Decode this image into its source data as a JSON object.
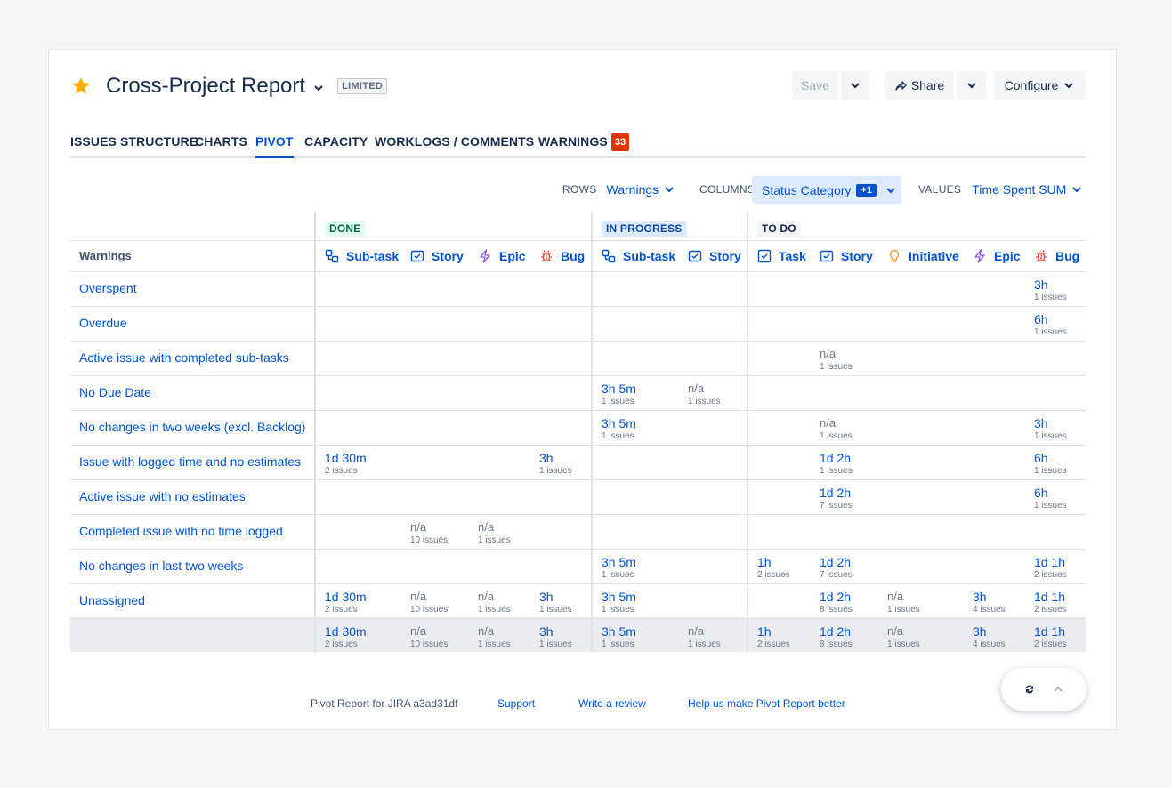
{
  "header": {
    "title": "Cross-Project Report",
    "badge": "LIMITED",
    "save_label": "Save",
    "share_label": "Share",
    "configure_label": "Configure",
    "star_color": "#ffab00"
  },
  "tabs": [
    {
      "label": "ISSUES STRUCTURE"
    },
    {
      "label": "CHARTS"
    },
    {
      "label": "PIVOT",
      "active": true
    },
    {
      "label": "CAPACITY"
    },
    {
      "label": "WORKLOGS / COMMENTS"
    },
    {
      "label": "WARNINGS",
      "count": "33"
    }
  ],
  "controls": {
    "rows_label": "ROWS",
    "rows_value": "Warnings",
    "columns_label": "COLUMNS",
    "columns_value": "Status Category",
    "columns_extra": "+1",
    "values_label": "VALUES",
    "values_value": "Time Spent SUM"
  },
  "pivot": {
    "row_header": "Warnings",
    "groups": [
      {
        "label": "DONE",
        "style": "done"
      },
      {
        "label": "IN PROGRESS",
        "style": "prog"
      },
      {
        "label": "TO DO",
        "style": "todo"
      }
    ],
    "columns": [
      {
        "label": "Sub-task",
        "icon": "subtask-icon"
      },
      {
        "label": "Story",
        "icon": "story-icon"
      },
      {
        "label": "Epic",
        "icon": "epic-icon"
      },
      {
        "label": "Bug",
        "icon": "bug-icon"
      },
      {
        "label": "Sub-task",
        "icon": "subtask-icon"
      },
      {
        "label": "Story",
        "icon": "story-icon"
      },
      {
        "label": "Task",
        "icon": "task-icon"
      },
      {
        "label": "Story",
        "icon": "story-icon"
      },
      {
        "label": "Initiative",
        "icon": "initiative-icon"
      },
      {
        "label": "Epic",
        "icon": "epic-icon"
      },
      {
        "label": "Bug",
        "icon": "bug-icon"
      }
    ],
    "rows": [
      {
        "name": "Overspent",
        "cells": {
          "10": [
            "3h",
            "1 issues"
          ]
        }
      },
      {
        "name": "Overdue",
        "cells": {
          "10": [
            "6h",
            "1 issues"
          ]
        }
      },
      {
        "name": "Active issue with completed sub-tasks",
        "cells": {
          "7": [
            "n/a",
            "1 issues"
          ]
        }
      },
      {
        "name": "No Due Date",
        "cells": {
          "4": [
            "3h 5m",
            "1 issues"
          ],
          "5": [
            "n/a",
            "1 issues"
          ]
        }
      },
      {
        "name": "No changes in two weeks (excl. Backlog)",
        "cells": {
          "4": [
            "3h 5m",
            "1 issues"
          ],
          "7": [
            "n/a",
            "1 issues"
          ],
          "10": [
            "3h",
            "1 issues"
          ]
        }
      },
      {
        "name": "Issue with logged time and no estimates",
        "cells": {
          "0": [
            "1d 30m",
            "2 issues"
          ],
          "3": [
            "3h",
            "1 issues"
          ],
          "7": [
            "1d 2h",
            "1 issues"
          ],
          "10": [
            "6h",
            "1 issues"
          ]
        }
      },
      {
        "name": "Active issue with no estimates",
        "cells": {
          "7": [
            "1d 2h",
            "7 issues"
          ],
          "10": [
            "6h",
            "1 issues"
          ]
        }
      },
      {
        "name": "Completed issue with no time logged",
        "cells": {
          "1": [
            "n/a",
            "10 issues"
          ],
          "2": [
            "n/a",
            "1 issues"
          ]
        }
      },
      {
        "name": "No changes in last two weeks",
        "cells": {
          "4": [
            "3h 5m",
            "1 issues"
          ],
          "6": [
            "1h",
            "2 issues"
          ],
          "7": [
            "1d 2h",
            "7 issues"
          ],
          "10": [
            "1d 1h",
            "2 issues"
          ]
        }
      },
      {
        "name": "Unassigned",
        "cells": {
          "0": [
            "1d 30m",
            "2 issues"
          ],
          "1": [
            "n/a",
            "10 issues"
          ],
          "2": [
            "n/a",
            "1 issues"
          ],
          "3": [
            "3h",
            "1 issues"
          ],
          "4": [
            "3h 5m",
            "1 issues"
          ],
          "7": [
            "1d 2h",
            "8 issues"
          ],
          "8": [
            "n/a",
            "1 issues"
          ],
          "9": [
            "3h",
            "4 issues"
          ],
          "10": [
            "1d 1h",
            "2 issues"
          ]
        }
      },
      {
        "name": "",
        "total": true,
        "cells": {
          "0": [
            "1d 30m",
            "2 issues"
          ],
          "1": [
            "n/a",
            "10 issues"
          ],
          "2": [
            "n/a",
            "1 issues"
          ],
          "3": [
            "3h",
            "1 issues"
          ],
          "4": [
            "3h 5m",
            "1 issues"
          ],
          "5": [
            "n/a",
            "1 issues"
          ],
          "6": [
            "1h",
            "2 issues"
          ],
          "7": [
            "1d 2h",
            "8 issues"
          ],
          "8": [
            "n/a",
            "1 issues"
          ],
          "9": [
            "3h",
            "4 issues"
          ],
          "10": [
            "1d 1h",
            "2 issues"
          ]
        }
      }
    ]
  },
  "footer": {
    "version": "Pivot Report for JIRA a3ad31df",
    "support": "Support",
    "review": "Write a review",
    "feedback": "Help us make Pivot Report better"
  }
}
